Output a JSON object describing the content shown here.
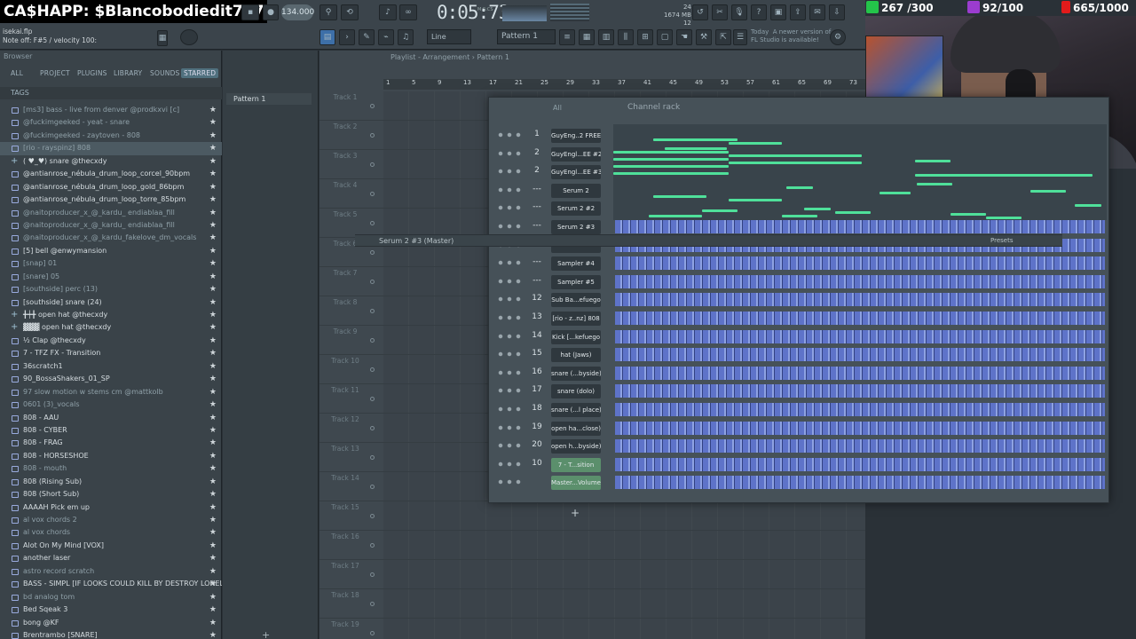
{
  "stream": {
    "cashapp": "CA$HAPP: $Blancobodiedit777",
    "stat1": "267 /300",
    "stat2": "92/100",
    "stat3": "665/1000",
    "colors": {
      "stat1": "#24c44a",
      "stat2": "#9b3ccf",
      "stat3": "#e21b1b"
    }
  },
  "toolbar": {
    "project": "isekai.flp",
    "hint": "Note off: F#5 / velocity 100:",
    "tempo": "134.000",
    "time": "0:05:73",
    "time_sub": "M:S:CS",
    "cpu_val": "24",
    "mem": "1674 MB",
    "poly": "12",
    "line_mode": "Line",
    "pattern": "Pattern 1",
    "news": "Today  A newer version of\nFL Studio is available!"
  },
  "browser": {
    "title": "Browser",
    "tabs": [
      "ALL",
      "PROJECT",
      "PLUGINS",
      "LIBRARY",
      "SOUNDS",
      "STARRED"
    ],
    "active_tab": "STARRED",
    "tags_label": "TAGS",
    "items": [
      {
        "t": "[ms3] bass - live from denver @prodkxvi [c]",
        "dim": true
      },
      {
        "t": "@fuckimgeeked - yeat - snare",
        "dim": true
      },
      {
        "t": "@fuckimgeeked - zaytoven - 808",
        "dim": true
      },
      {
        "t": "[rio - rayspinz] 808",
        "dim": true,
        "sel": true
      },
      {
        "t": "( ♥_♥) snare @thecxdy",
        "plus": true
      },
      {
        "t": "@antianrose_nébula_drum_loop_corcel_90bpm"
      },
      {
        "t": "@antianrose_nébula_drum_loop_gold_86bpm"
      },
      {
        "t": "@antianrose_nébula_drum_loop_torre_85bpm"
      },
      {
        "t": "@naitoproducer_x_@_kardu_ endiablaa_fill",
        "dim": true
      },
      {
        "t": "@naitoproducer_x_@_kardu_ endiablaa_fill",
        "dim": true
      },
      {
        "t": "@naitoproducer_x_@_kardu_fakelove_dm_vocals",
        "dim": true
      },
      {
        "t": "[5] bell @enwymansion"
      },
      {
        "t": "[snap] 01",
        "dim": true
      },
      {
        "t": "[snare] 05",
        "dim": true
      },
      {
        "t": "[southside] perc (13)",
        "dim": true
      },
      {
        "t": "[southside] snare (24)"
      },
      {
        "t": "╋┿╋ open hat @thecxdy",
        "plus": true
      },
      {
        "t": "▓▓▓ open hat @thecxdy",
        "plus": true
      },
      {
        "t": "½ Clap @thecxdy"
      },
      {
        "t": "7 - TFZ FX - Transition"
      },
      {
        "t": "36scratch1"
      },
      {
        "t": "90_BossaShakers_01_SP"
      },
      {
        "t": "97 slow motion w stems cm @mattkolb",
        "dim": true
      },
      {
        "t": "0601 (3)_vocals",
        "dim": true
      },
      {
        "t": "808 - AAU"
      },
      {
        "t": "808 - CYBER"
      },
      {
        "t": "808 - FRAG"
      },
      {
        "t": "808 - HORSESHOE"
      },
      {
        "t": "808 - mouth",
        "dim": true
      },
      {
        "t": "808 (Rising Sub)"
      },
      {
        "t": "808 (Short Sub)"
      },
      {
        "t": "AAAAH Pick em up"
      },
      {
        "t": "al vox chords 2",
        "dim": true
      },
      {
        "t": "al vox chords",
        "dim": true
      },
      {
        "t": "Alot On My Mind [VOX]"
      },
      {
        "t": "another laser"
      },
      {
        "t": "astro record scratch",
        "dim": true
      },
      {
        "t": "BASS - SIMPL [IF LOOKS COULD KILL BY DESTROY LONELY]"
      },
      {
        "t": "bd analog tom",
        "dim": true
      },
      {
        "t": "Bed Sqeak 3"
      },
      {
        "t": "bong @KF"
      },
      {
        "t": "Brentrambo [SNARE]"
      }
    ]
  },
  "picker": {
    "pattern": "Pattern 1"
  },
  "playlist": {
    "title": "Playlist - Arrangement › Pattern 1",
    "ruler": [
      "1",
      "5",
      "9",
      "13",
      "17",
      "21",
      "25",
      "29",
      "33",
      "37",
      "41",
      "45",
      "49",
      "53",
      "57",
      "61",
      "65",
      "69",
      "73"
    ],
    "tracks": [
      "Track 1",
      "Track 2",
      "Track 3",
      "Track 4",
      "Track 5",
      "Track 6",
      "Track 7",
      "Track 8",
      "Track 9",
      "Track 10",
      "Track 11",
      "Track 12",
      "Track 13",
      "Track 14",
      "Track 15",
      "Track 16",
      "Track 17",
      "Track 18",
      "Track 19"
    ]
  },
  "channel_rack": {
    "title": "Channel rack",
    "filter": "All",
    "serum_strip": "Serum 2 #3 (Master)",
    "presets": "Presets",
    "channels": [
      {
        "num": "1",
        "name": "GuyEng..2 FREE"
      },
      {
        "num": "2",
        "name": "GuyEngl...EE #2"
      },
      {
        "num": "2",
        "name": "GuyEngl...EE #3"
      },
      {
        "num": "---",
        "name": "Serum 2"
      },
      {
        "num": "---",
        "name": "Serum 2 #2"
      },
      {
        "num": "---",
        "name": "Serum 2 #3"
      },
      {
        "num": "",
        "name": ""
      },
      {
        "num": "---",
        "name": "Sampler #4"
      },
      {
        "num": "---",
        "name": "Sampler #5"
      },
      {
        "num": "12",
        "name": "Sub Ba...efuego"
      },
      {
        "num": "13",
        "name": "[rio - z..nz] 808"
      },
      {
        "num": "14",
        "name": "Kick [...kefuego"
      },
      {
        "num": "15",
        "name": "hat (Jaws)"
      },
      {
        "num": "16",
        "name": "snare (...byside)"
      },
      {
        "num": "17",
        "name": "snare (dolo)"
      },
      {
        "num": "18",
        "name": "snare (...l place)"
      },
      {
        "num": "19",
        "name": "open ha...close)"
      },
      {
        "num": "20",
        "name": "open h...byside)"
      },
      {
        "num": "10",
        "name": "7 - T...sition"
      },
      {
        "num": "",
        "name": "Master...Volume"
      }
    ]
  }
}
